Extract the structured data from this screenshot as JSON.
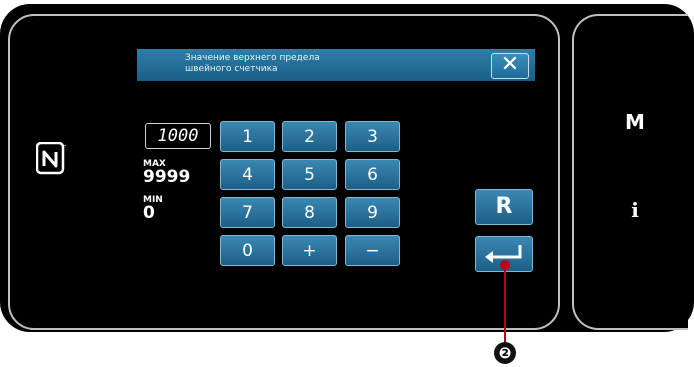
{
  "dialog": {
    "title": "Значение верхнего предела\nшвейного счетчика",
    "close_icon": "close-icon"
  },
  "value_display": "1000",
  "limits": {
    "max_label": "MAX",
    "max_value": "9999",
    "min_label": "MIN",
    "min_value": "0"
  },
  "keypad": {
    "keys": [
      "1",
      "2",
      "3",
      "4",
      "5",
      "6",
      "7",
      "8",
      "9",
      "0",
      "+",
      "−"
    ]
  },
  "buttons": {
    "reset": "R",
    "enter_icon": "enter-icon"
  },
  "side_panel": {
    "mode_button": "M",
    "info_button": "i"
  },
  "callout": {
    "number": "❷"
  },
  "colors": {
    "panel_bg": "#000000",
    "key_blue": "#2a77a3",
    "callout_red": "#c00018"
  }
}
